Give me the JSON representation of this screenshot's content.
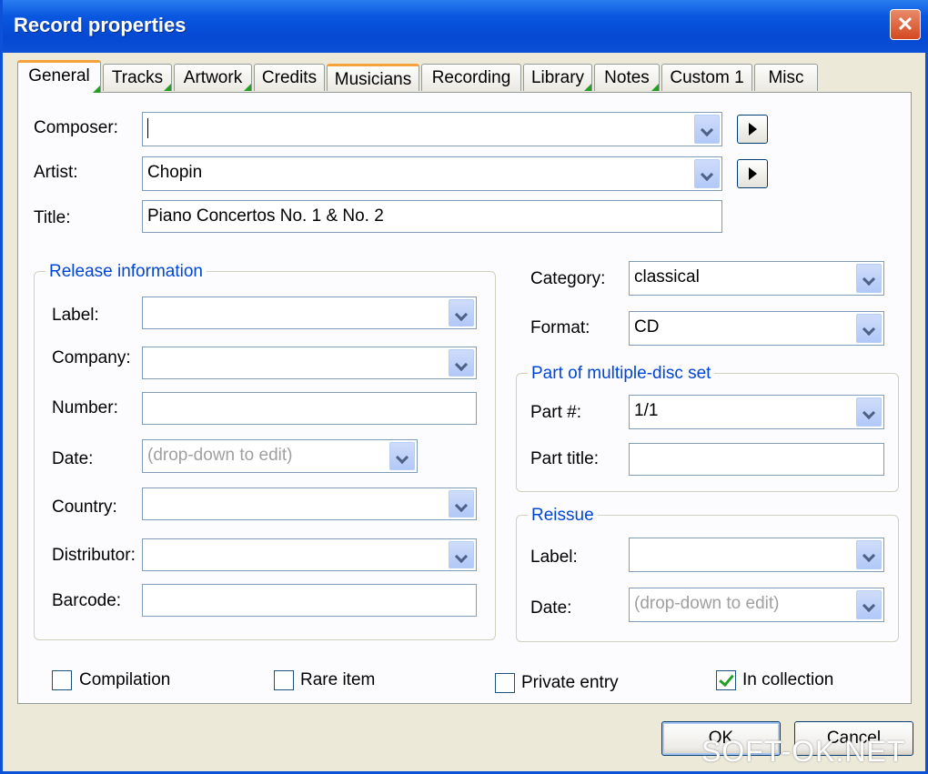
{
  "window": {
    "title": "Record properties",
    "close_glyph": "✕"
  },
  "tabs": [
    {
      "label": "General"
    },
    {
      "label": "Tracks"
    },
    {
      "label": "Artwork"
    },
    {
      "label": "Credits"
    },
    {
      "label": "Musicians"
    },
    {
      "label": "Recording"
    },
    {
      "label": "Library"
    },
    {
      "label": "Notes"
    },
    {
      "label": "Custom 1"
    },
    {
      "label": "Misc"
    }
  ],
  "general": {
    "composer_label": "Composer:",
    "composer_value": "",
    "artist_label": "Artist:",
    "artist_value": "Chopin",
    "title_label": "Title:",
    "title_value": "Piano Concertos No. 1 & No. 2"
  },
  "release": {
    "legend": "Release information",
    "label_label": "Label:",
    "label_value": "",
    "company_label": "Company:",
    "company_value": "",
    "number_label": "Number:",
    "number_value": "",
    "date_label": "Date:",
    "date_value": "(drop-down to edit)",
    "country_label": "Country:",
    "country_value": "",
    "distributor_label": "Distributor:",
    "distributor_value": "",
    "barcode_label": "Barcode:",
    "barcode_value": ""
  },
  "classification": {
    "category_label": "Category:",
    "category_value": "classical",
    "format_label": "Format:",
    "format_value": "CD"
  },
  "multidisc": {
    "legend": "Part of multiple-disc set",
    "part_label": "Part #:",
    "part_value": "1/1",
    "part_title_label": "Part title:",
    "part_title_value": ""
  },
  "reissue": {
    "legend": "Reissue",
    "label_label": "Label:",
    "label_value": "",
    "date_label": "Date:",
    "date_value": "(drop-down to edit)"
  },
  "checkboxes": {
    "compilation": {
      "label": "Compilation",
      "checked": false
    },
    "rare": {
      "label": "Rare item",
      "checked": false
    },
    "private": {
      "label": "Private entry",
      "checked": false
    },
    "collection": {
      "label": "In collection",
      "checked": true
    }
  },
  "buttons": {
    "ok": "OK",
    "cancel": "Cancel"
  },
  "watermark": "SOFT-OK.NET",
  "colors": {
    "titlebar": "#0548d2",
    "accent_tab": "#f6a23c",
    "legend": "#0046d5",
    "check": "#21a121"
  }
}
